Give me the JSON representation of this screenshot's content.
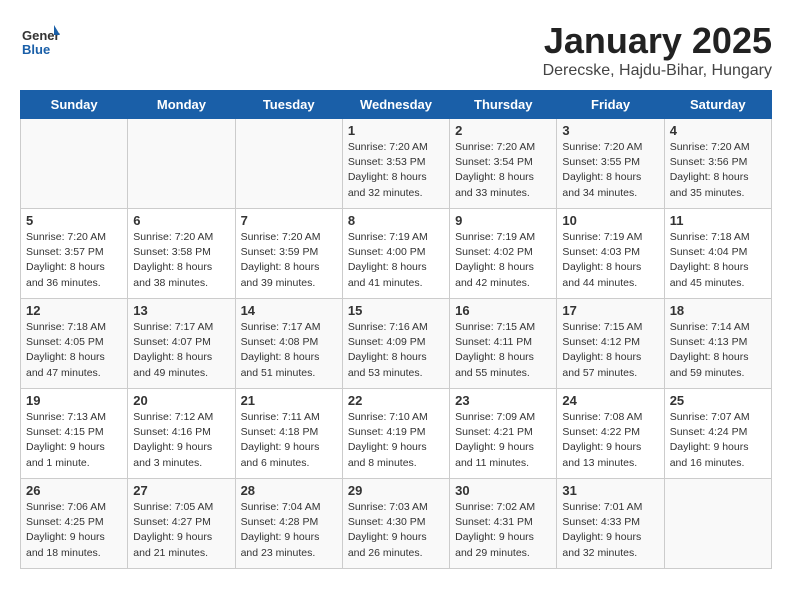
{
  "header": {
    "logo_general": "General",
    "logo_blue": "Blue",
    "month": "January 2025",
    "location": "Derecske, Hajdu-Bihar, Hungary"
  },
  "days_of_week": [
    "Sunday",
    "Monday",
    "Tuesday",
    "Wednesday",
    "Thursday",
    "Friday",
    "Saturday"
  ],
  "weeks": [
    [
      {
        "day": "",
        "content": ""
      },
      {
        "day": "",
        "content": ""
      },
      {
        "day": "",
        "content": ""
      },
      {
        "day": "1",
        "content": "Sunrise: 7:20 AM\nSunset: 3:53 PM\nDaylight: 8 hours and 32 minutes."
      },
      {
        "day": "2",
        "content": "Sunrise: 7:20 AM\nSunset: 3:54 PM\nDaylight: 8 hours and 33 minutes."
      },
      {
        "day": "3",
        "content": "Sunrise: 7:20 AM\nSunset: 3:55 PM\nDaylight: 8 hours and 34 minutes."
      },
      {
        "day": "4",
        "content": "Sunrise: 7:20 AM\nSunset: 3:56 PM\nDaylight: 8 hours and 35 minutes."
      }
    ],
    [
      {
        "day": "5",
        "content": "Sunrise: 7:20 AM\nSunset: 3:57 PM\nDaylight: 8 hours and 36 minutes."
      },
      {
        "day": "6",
        "content": "Sunrise: 7:20 AM\nSunset: 3:58 PM\nDaylight: 8 hours and 38 minutes."
      },
      {
        "day": "7",
        "content": "Sunrise: 7:20 AM\nSunset: 3:59 PM\nDaylight: 8 hours and 39 minutes."
      },
      {
        "day": "8",
        "content": "Sunrise: 7:19 AM\nSunset: 4:00 PM\nDaylight: 8 hours and 41 minutes."
      },
      {
        "day": "9",
        "content": "Sunrise: 7:19 AM\nSunset: 4:02 PM\nDaylight: 8 hours and 42 minutes."
      },
      {
        "day": "10",
        "content": "Sunrise: 7:19 AM\nSunset: 4:03 PM\nDaylight: 8 hours and 44 minutes."
      },
      {
        "day": "11",
        "content": "Sunrise: 7:18 AM\nSunset: 4:04 PM\nDaylight: 8 hours and 45 minutes."
      }
    ],
    [
      {
        "day": "12",
        "content": "Sunrise: 7:18 AM\nSunset: 4:05 PM\nDaylight: 8 hours and 47 minutes."
      },
      {
        "day": "13",
        "content": "Sunrise: 7:17 AM\nSunset: 4:07 PM\nDaylight: 8 hours and 49 minutes."
      },
      {
        "day": "14",
        "content": "Sunrise: 7:17 AM\nSunset: 4:08 PM\nDaylight: 8 hours and 51 minutes."
      },
      {
        "day": "15",
        "content": "Sunrise: 7:16 AM\nSunset: 4:09 PM\nDaylight: 8 hours and 53 minutes."
      },
      {
        "day": "16",
        "content": "Sunrise: 7:15 AM\nSunset: 4:11 PM\nDaylight: 8 hours and 55 minutes."
      },
      {
        "day": "17",
        "content": "Sunrise: 7:15 AM\nSunset: 4:12 PM\nDaylight: 8 hours and 57 minutes."
      },
      {
        "day": "18",
        "content": "Sunrise: 7:14 AM\nSunset: 4:13 PM\nDaylight: 8 hours and 59 minutes."
      }
    ],
    [
      {
        "day": "19",
        "content": "Sunrise: 7:13 AM\nSunset: 4:15 PM\nDaylight: 9 hours and 1 minute."
      },
      {
        "day": "20",
        "content": "Sunrise: 7:12 AM\nSunset: 4:16 PM\nDaylight: 9 hours and 3 minutes."
      },
      {
        "day": "21",
        "content": "Sunrise: 7:11 AM\nSunset: 4:18 PM\nDaylight: 9 hours and 6 minutes."
      },
      {
        "day": "22",
        "content": "Sunrise: 7:10 AM\nSunset: 4:19 PM\nDaylight: 9 hours and 8 minutes."
      },
      {
        "day": "23",
        "content": "Sunrise: 7:09 AM\nSunset: 4:21 PM\nDaylight: 9 hours and 11 minutes."
      },
      {
        "day": "24",
        "content": "Sunrise: 7:08 AM\nSunset: 4:22 PM\nDaylight: 9 hours and 13 minutes."
      },
      {
        "day": "25",
        "content": "Sunrise: 7:07 AM\nSunset: 4:24 PM\nDaylight: 9 hours and 16 minutes."
      }
    ],
    [
      {
        "day": "26",
        "content": "Sunrise: 7:06 AM\nSunset: 4:25 PM\nDaylight: 9 hours and 18 minutes."
      },
      {
        "day": "27",
        "content": "Sunrise: 7:05 AM\nSunset: 4:27 PM\nDaylight: 9 hours and 21 minutes."
      },
      {
        "day": "28",
        "content": "Sunrise: 7:04 AM\nSunset: 4:28 PM\nDaylight: 9 hours and 23 minutes."
      },
      {
        "day": "29",
        "content": "Sunrise: 7:03 AM\nSunset: 4:30 PM\nDaylight: 9 hours and 26 minutes."
      },
      {
        "day": "30",
        "content": "Sunrise: 7:02 AM\nSunset: 4:31 PM\nDaylight: 9 hours and 29 minutes."
      },
      {
        "day": "31",
        "content": "Sunrise: 7:01 AM\nSunset: 4:33 PM\nDaylight: 9 hours and 32 minutes."
      },
      {
        "day": "",
        "content": ""
      }
    ]
  ]
}
